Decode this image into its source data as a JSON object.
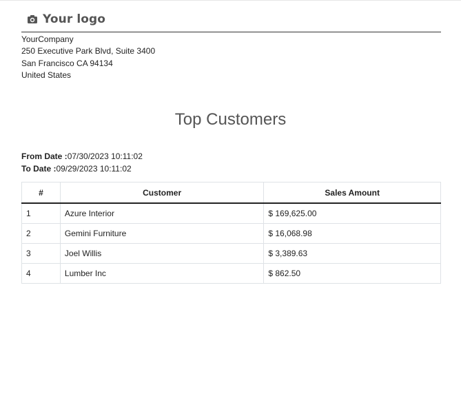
{
  "logo": {
    "icon": "camera-icon",
    "text": "Your logo"
  },
  "company": {
    "name": "YourCompany",
    "street": "250 Executive Park Blvd, Suite 3400",
    "city_line": "San Francisco CA 94134",
    "country": "United States"
  },
  "report": {
    "title": "Top Customers",
    "from_label": "From Date :",
    "from_value": "07/30/2023 10:11:02",
    "to_label": "To Date :",
    "to_value": "09/29/2023 10:11:02"
  },
  "table": {
    "headers": [
      "#",
      "Customer",
      "Sales Amount"
    ],
    "rows": [
      {
        "num": "1",
        "customer": "Azure Interior",
        "amount": "$ 169,625.00"
      },
      {
        "num": "2",
        "customer": "Gemini Furniture",
        "amount": "$ 16,068.98"
      },
      {
        "num": "3",
        "customer": "Joel Willis",
        "amount": "$ 3,389.63"
      },
      {
        "num": "4",
        "customer": "Lumber Inc",
        "amount": "$ 862.50"
      }
    ]
  }
}
